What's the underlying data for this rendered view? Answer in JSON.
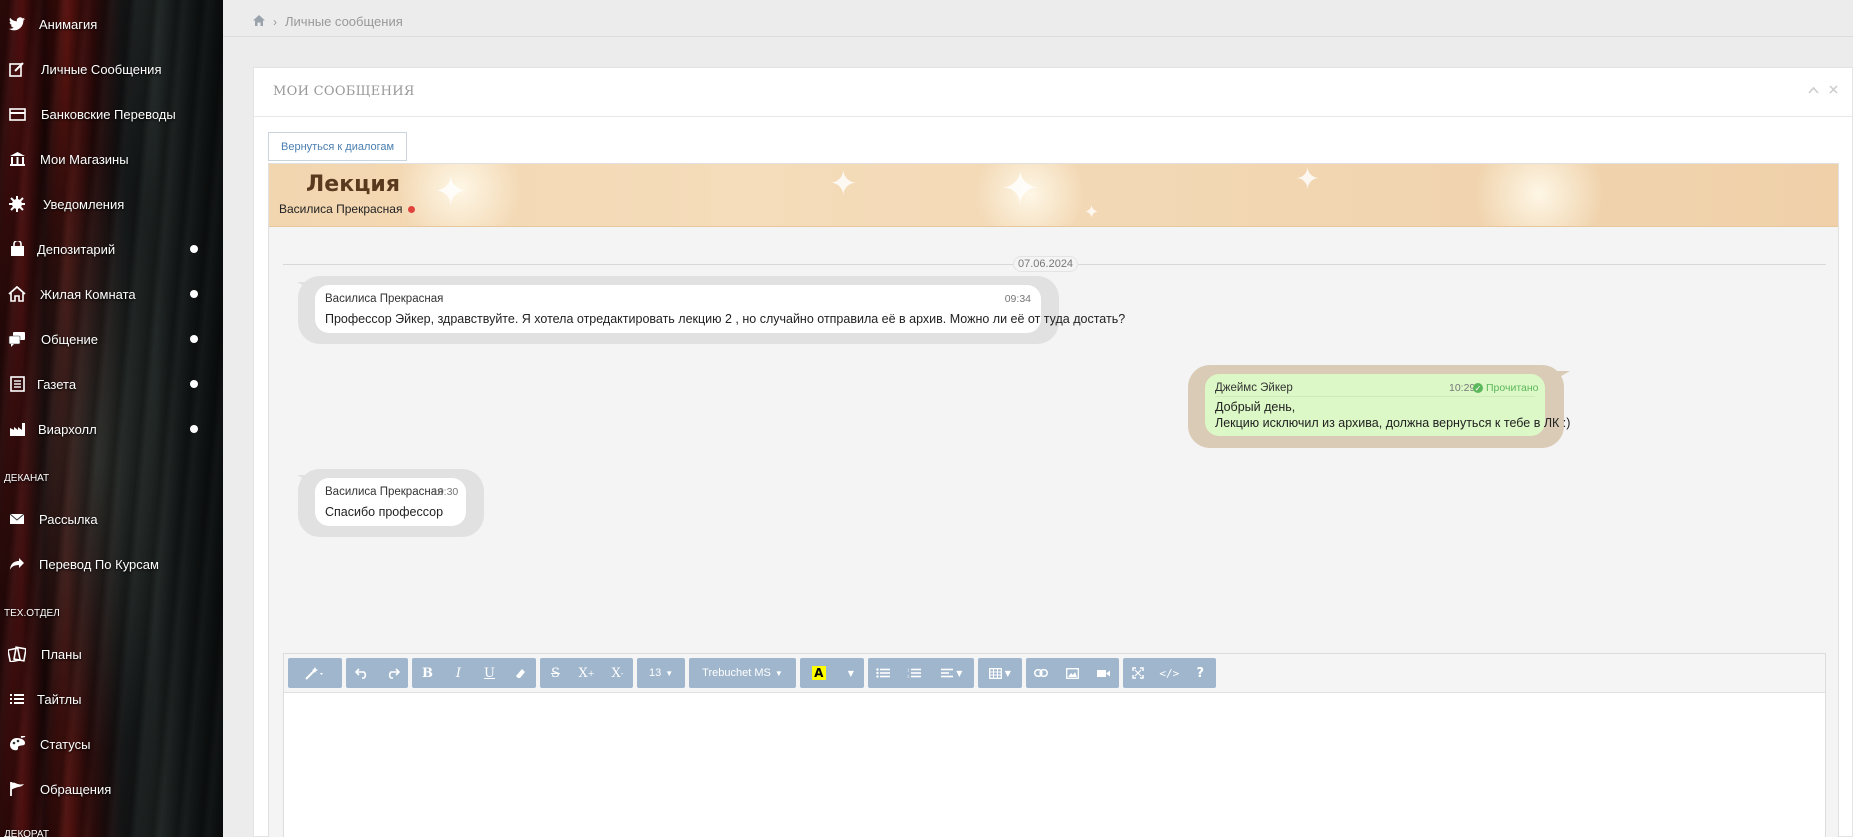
{
  "sidebar": {
    "items": [
      {
        "label": "Анимагия",
        "icon": "twitter-bird-icon",
        "dot": false
      },
      {
        "label": "Личные Сообщения",
        "icon": "edit-icon",
        "dot": false
      },
      {
        "label": "Банковские Переводы",
        "icon": "credit-card-icon",
        "dot": false
      },
      {
        "label": "Мои Магазины",
        "icon": "bank-icon",
        "dot": false
      },
      {
        "label": "Уведомления",
        "icon": "gear-burst-icon",
        "dot": false
      },
      {
        "label": "Депозитарий",
        "icon": "bag-icon",
        "dot": true
      },
      {
        "label": "Жилая Комната",
        "icon": "home-icon",
        "dot": true
      },
      {
        "label": "Общение",
        "icon": "chat-icon",
        "dot": true
      },
      {
        "label": "Газета",
        "icon": "newspaper-icon",
        "dot": true
      },
      {
        "label": "Виархолл",
        "icon": "factory-icon",
        "dot": true
      }
    ],
    "section_dean": "ДЕКАНАТ",
    "dean_items": [
      {
        "label": "Рассылка",
        "icon": "envelope-icon"
      },
      {
        "label": "Перевод По Курсам",
        "icon": "share-arrow-icon"
      }
    ],
    "section_tech": "ТЕХ.ОТДЕЛ",
    "tech_items": [
      {
        "label": "Планы",
        "icon": "cards-icon"
      },
      {
        "label": "Тайтлы",
        "icon": "list-icon"
      },
      {
        "label": "Статусы",
        "icon": "palette-icon"
      },
      {
        "label": "Обращения",
        "icon": "flag-icon"
      }
    ],
    "section_cut": "ДЕКОРАТ"
  },
  "breadcrumb": {
    "home_icon": "home-icon",
    "current": "Личные сообщения"
  },
  "panel": {
    "title": "МОИ СООБЩЕНИЯ"
  },
  "back_button": "Вернуться к диалогам",
  "dialog": {
    "title": "Лекция",
    "participant": "Василиса Прекрасная",
    "date": "07.06.2024"
  },
  "messages": [
    {
      "author": "Василиса Прекрасная",
      "time": "09:34",
      "text": "Профессор Эйкер, здравствуйте. Я хотела отредактировать лекцию 2 , но случайно отправила её в архив. Можно ли её от туда достать?"
    },
    {
      "author": "Джеймс Эйкер",
      "time": "10:29",
      "status": "Прочитано",
      "text_line1": "Добрый день,",
      "text_line2": "Лекцию исключил из архива, должна вернуться к тебе в ЛК :)"
    },
    {
      "author": "Василиса Прекрасная",
      "time": "10:30",
      "text": "Спасибо профессор"
    }
  ],
  "toolbar": {
    "font_size": "13",
    "font_family": "Trebuchet MS"
  },
  "colors": {
    "banner": "#f2d6b0",
    "toolbar": "#9fb6cc",
    "own_bubble": "#dcf8c6",
    "read_status": "#5cb85c",
    "online_dot": "#e0433b"
  }
}
